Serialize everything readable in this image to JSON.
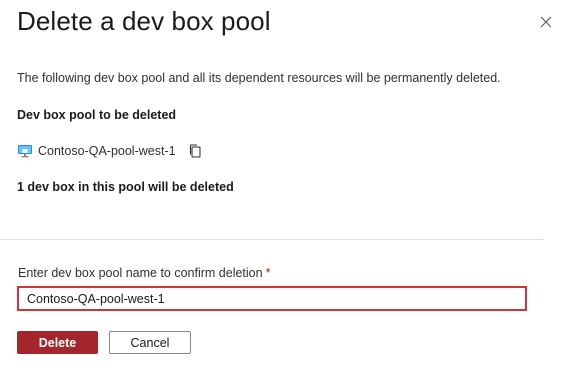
{
  "dialog": {
    "title": "Delete a dev box pool",
    "description": "The following dev box pool and all its dependent resources will be permanently deleted.",
    "section_label": "Dev box pool to be deleted",
    "pool": {
      "name": "Contoso-QA-pool-west-1",
      "icon": "dev-box-pool-icon"
    },
    "copy_icon": "copy-icon",
    "count_text": "1 dev box in this pool will be deleted",
    "confirm": {
      "label": "Enter dev box pool name to confirm deletion",
      "required_marker": "*",
      "value": "Contoso-QA-pool-west-1"
    },
    "buttons": {
      "delete_label": "Delete",
      "cancel_label": "Cancel"
    },
    "close_icon": "close-icon"
  },
  "colors": {
    "danger": "#a4262c",
    "input_error_border": "#d13438",
    "divider": "#e1dfdd"
  }
}
